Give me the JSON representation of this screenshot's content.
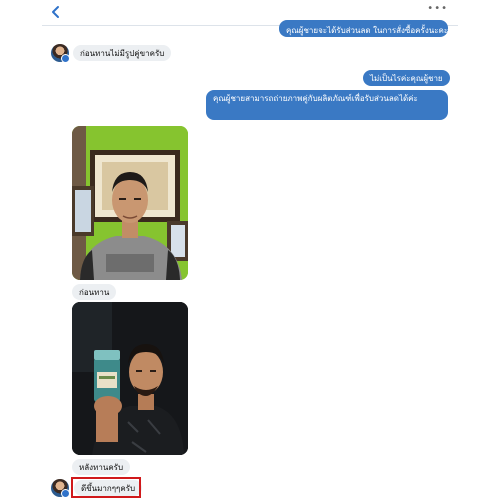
{
  "header": {
    "back_icon": "chevron-left-icon",
    "more_label": "•••"
  },
  "colors": {
    "outgoing_bubble": "#3a79c4",
    "incoming_bubble": "#eceff2",
    "highlight": "#d0191b",
    "accent": "#2f72c9"
  },
  "messages": {
    "out_1": "คุณผู้ชายจะได้รับส่วนลด ในการสั่งซื้อครั้งนะคะ",
    "in_1": "ก่อนทานไม่มีรูปคู่ขาครับ",
    "out_2": "ไม่เป็นไรค่ะคุณผู้ชาย",
    "out_3": "คุณผู้ชายสามารถถ่ายภาพคู่กับผลิตภัณฑ์เพื่อรับส่วนลดได้ค่ะ",
    "caption_before": "ก่อนทาน",
    "caption_after": "หลังทานครับ",
    "in_last": "ดีขึ้นมากๆๆครับ"
  }
}
